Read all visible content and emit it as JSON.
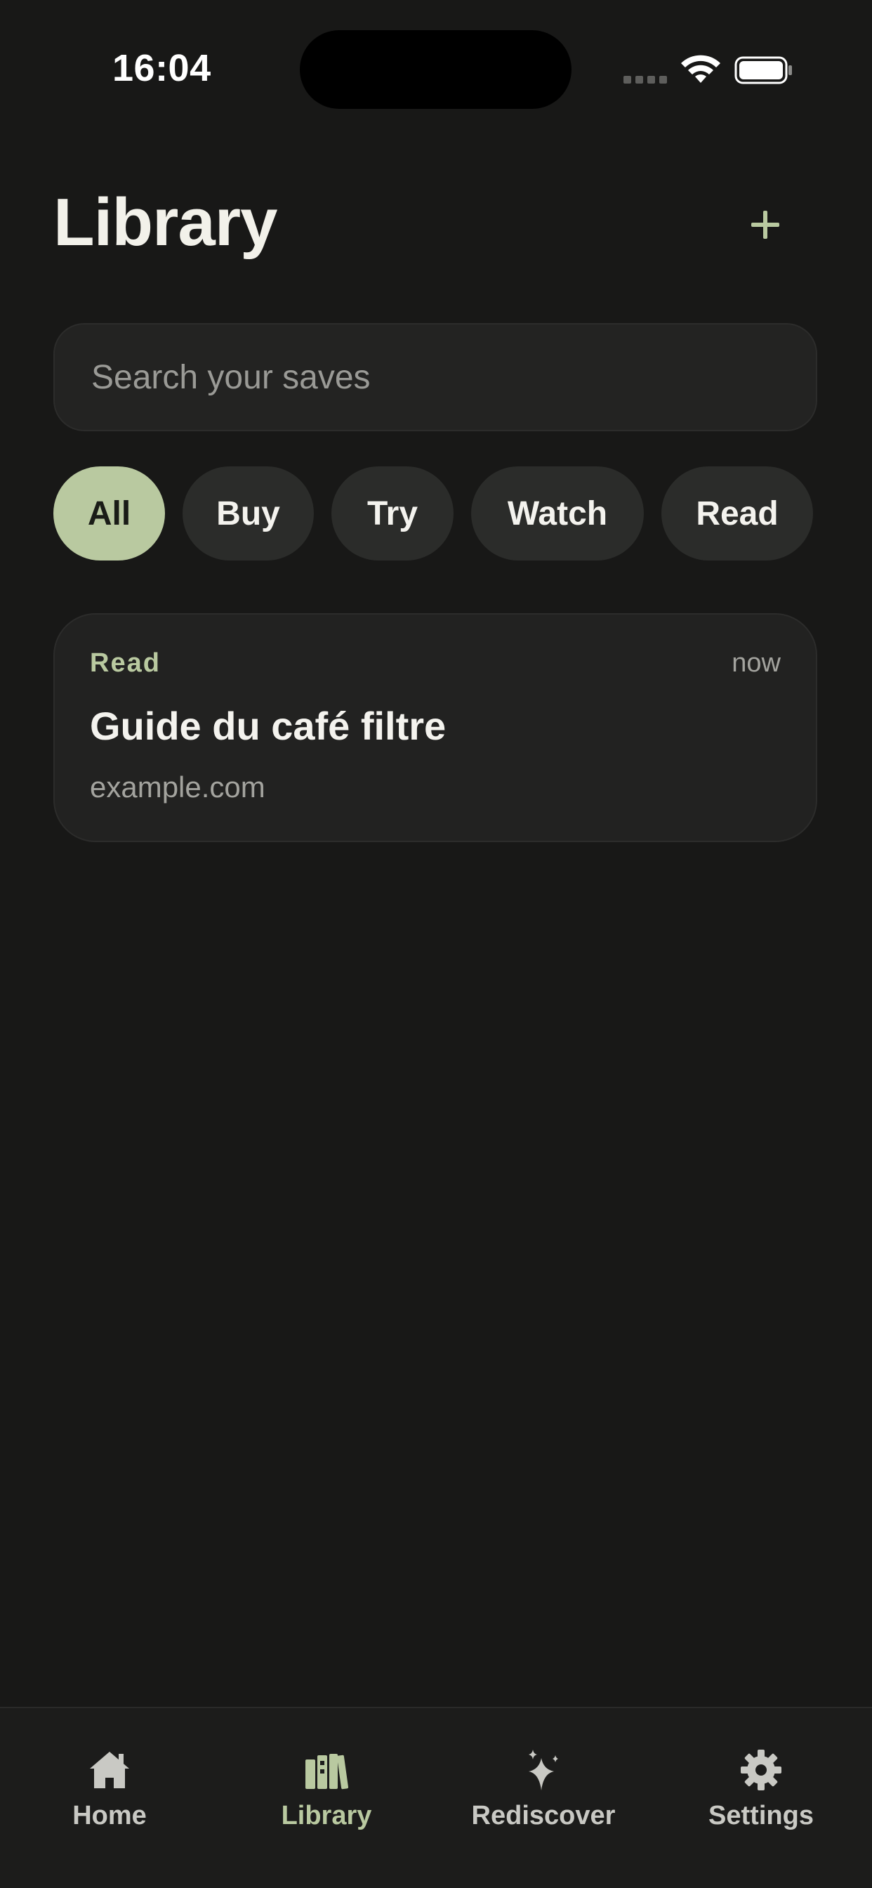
{
  "status_bar": {
    "time": "16:04"
  },
  "header": {
    "title": "Library",
    "add_icon": "plus-icon"
  },
  "search": {
    "placeholder": "Search your saves",
    "value": ""
  },
  "filters": [
    {
      "label": "All",
      "active": true
    },
    {
      "label": "Buy",
      "active": false
    },
    {
      "label": "Try",
      "active": false
    },
    {
      "label": "Watch",
      "active": false
    },
    {
      "label": "Read",
      "active": false
    }
  ],
  "items": [
    {
      "category": "Read",
      "time": "now",
      "title": "Guide du café filtre",
      "domain": "example.com"
    }
  ],
  "tabbar": {
    "tabs": [
      {
        "label": "Home",
        "icon": "home-icon",
        "active": false
      },
      {
        "label": "Library",
        "icon": "books-icon",
        "active": true
      },
      {
        "label": "Rediscover",
        "icon": "sparkles-icon",
        "active": false
      },
      {
        "label": "Settings",
        "icon": "gear-icon",
        "active": false
      }
    ]
  },
  "colors": {
    "background": "#181817",
    "accent": "#b9c9a0",
    "chip": "#2b2c2a",
    "card": "#222221"
  }
}
